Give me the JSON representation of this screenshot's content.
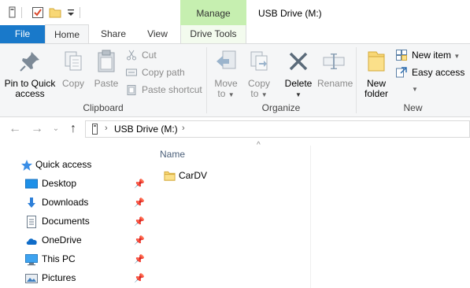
{
  "window": {
    "title": "USB Drive (M:)",
    "context_tab_header": "Manage"
  },
  "tabs": {
    "file": "File",
    "home": "Home",
    "share": "Share",
    "view": "View",
    "drive_tools": "Drive Tools"
  },
  "ribbon": {
    "clipboard": {
      "group_label": "Clipboard",
      "pin_line1": "Pin to Quick",
      "pin_line2": "access",
      "copy": "Copy",
      "paste": "Paste",
      "cut": "Cut",
      "copy_path": "Copy path",
      "paste_shortcut": "Paste shortcut"
    },
    "organize": {
      "group_label": "Organize",
      "move_to_line1": "Move",
      "move_to_line2": "to",
      "copy_to_line1": "Copy",
      "copy_to_line2": "to",
      "delete": "Delete",
      "rename": "Rename"
    },
    "new": {
      "group_label": "New",
      "new_folder_line1": "New",
      "new_folder_line2": "folder",
      "new_item": "New item",
      "easy_access": "Easy access"
    }
  },
  "address": {
    "path": "USB Drive (M:)"
  },
  "sidebar": {
    "items": [
      {
        "label": "Quick access",
        "icon": "star-icon",
        "pinned": false
      },
      {
        "label": "Desktop",
        "icon": "desktop-icon",
        "pinned": true
      },
      {
        "label": "Downloads",
        "icon": "download-icon",
        "pinned": true
      },
      {
        "label": "Documents",
        "icon": "documents-icon",
        "pinned": true
      },
      {
        "label": "OneDrive",
        "icon": "cloud-icon",
        "pinned": true
      },
      {
        "label": "This PC",
        "icon": "computer-icon",
        "pinned": true
      },
      {
        "label": "Pictures",
        "icon": "pictures-icon",
        "pinned": true
      }
    ]
  },
  "filelist": {
    "column_name": "Name",
    "items": [
      {
        "name": "CarDV",
        "icon": "folder-icon"
      }
    ]
  },
  "colors": {
    "file_tab": "#1979ca",
    "manage_tab": "#c6efb0",
    "ribbon_bg": "#f5f6f7",
    "folder_yellow": "#f8d775"
  }
}
